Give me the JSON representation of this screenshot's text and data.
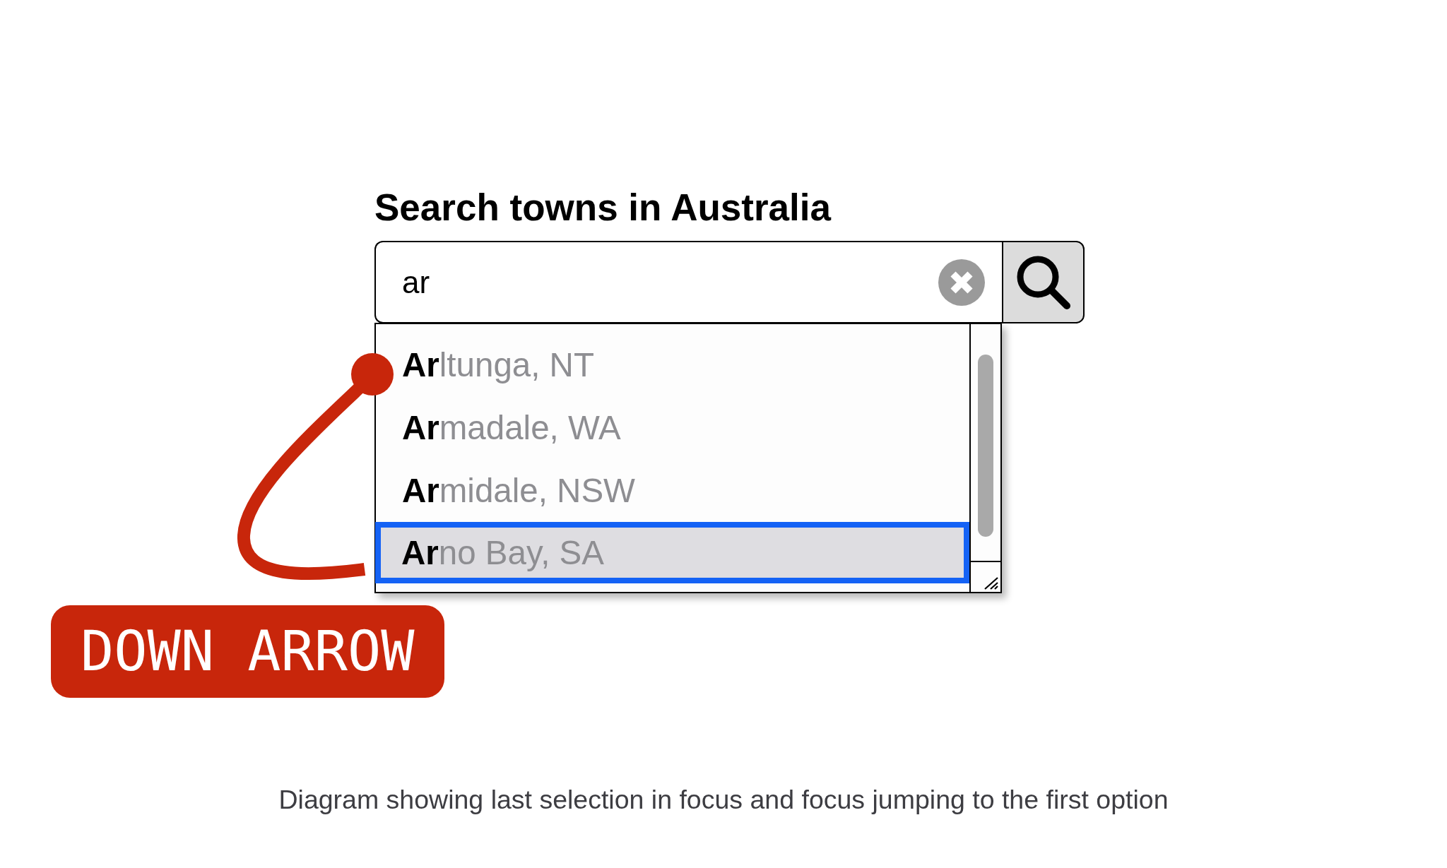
{
  "search": {
    "label": "Search towns in Australia",
    "value": "ar"
  },
  "suggestions": [
    {
      "label": "**Ar**ltunga, NT",
      "selected": false
    },
    {
      "label": "**Ar**madale, WA",
      "selected": false
    },
    {
      "label": "**Ar**midale, NSW",
      "selected": false
    },
    {
      "label": "**Ar**no Bay, SA",
      "selected": true
    }
  ],
  "key_badge": {
    "label": "DOWN ARROW"
  },
  "caption": "Diagram showing last selection in focus and focus jumping to the first option"
}
